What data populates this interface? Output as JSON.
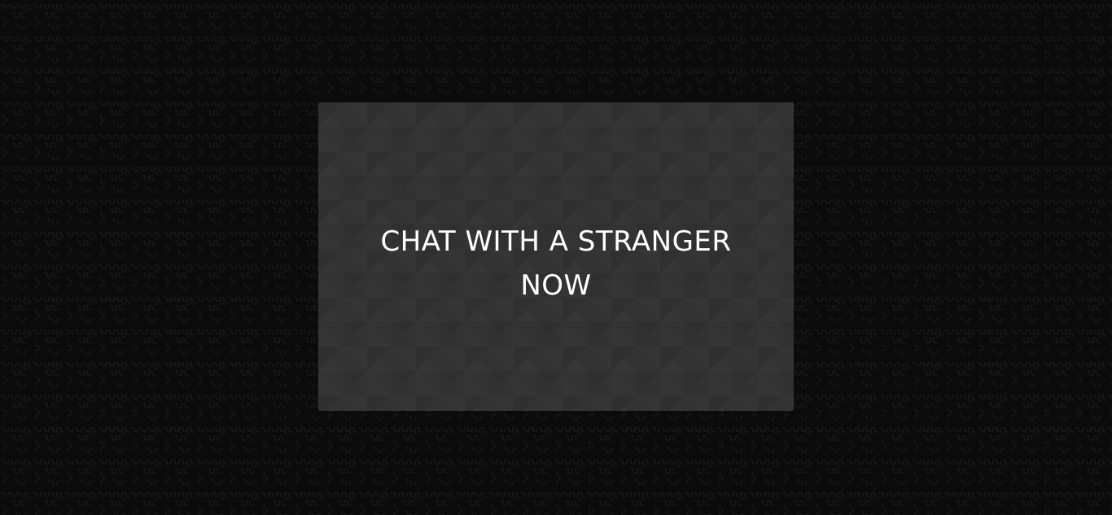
{
  "page": {
    "background_color": "#0b0b0b",
    "pattern_color": "#1c1c1c"
  },
  "card": {
    "background_color": "#333333",
    "title_line1": "CHAT WITH A STRANGER",
    "title_line2": "NOW",
    "text_color": "#ffffff"
  }
}
